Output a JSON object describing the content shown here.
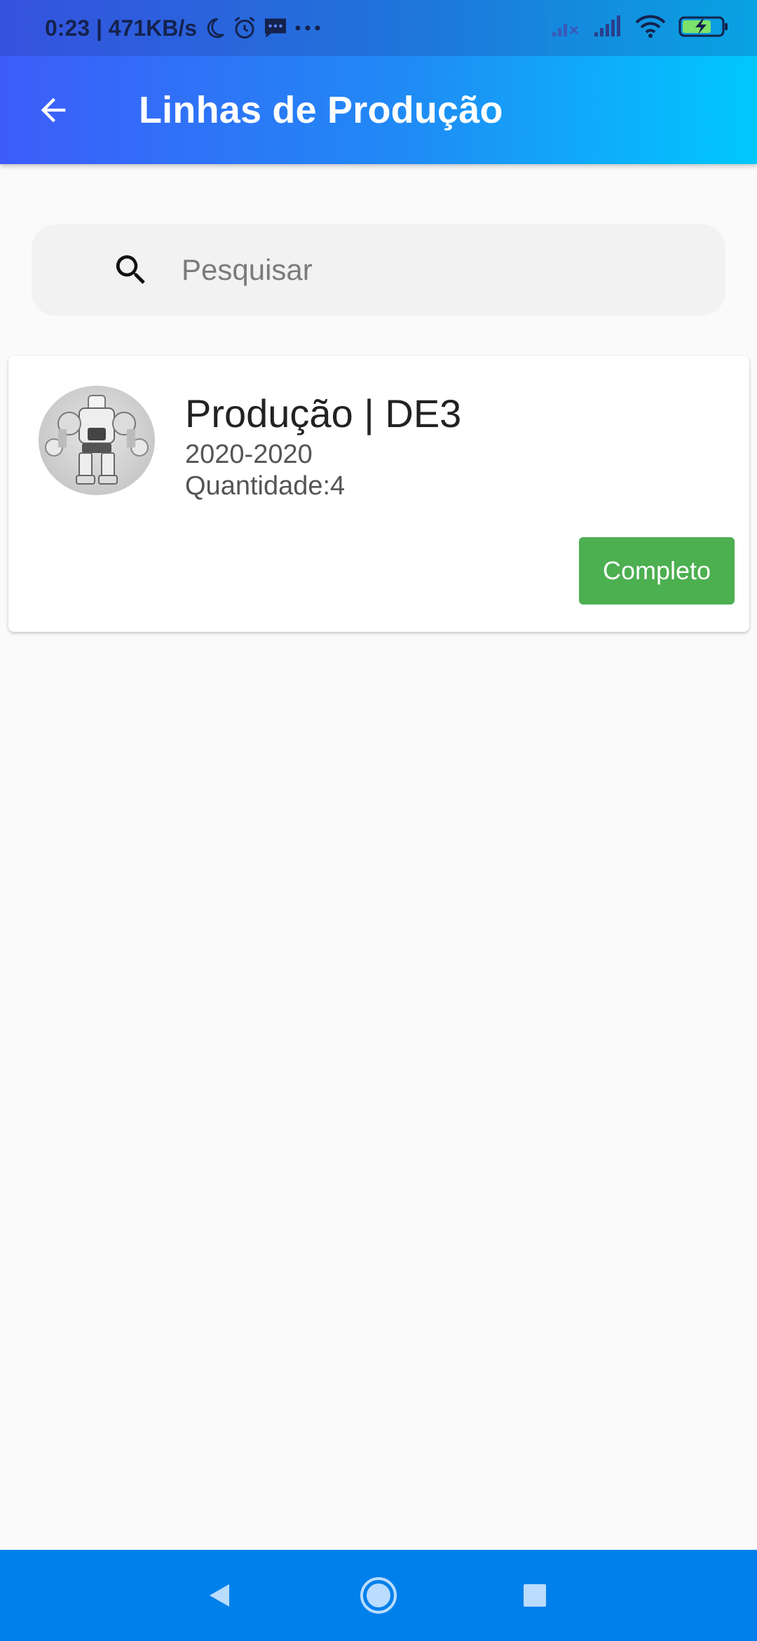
{
  "status_bar": {
    "time_speed": "0:23 | 471KB/s",
    "icons": [
      "moon-icon",
      "alarm-icon",
      "message-icon",
      "more-dots-icon",
      "signal-off-icon",
      "signal-icon",
      "wifi-icon",
      "battery-charging-icon"
    ]
  },
  "app_bar": {
    "title": "Linhas de Produção",
    "back_icon": "arrow-left-icon"
  },
  "search": {
    "placeholder": "Pesquisar",
    "value": "",
    "icon": "search-icon"
  },
  "list": {
    "items": [
      {
        "title": "Produção | DE3",
        "years": "2020-2020",
        "quantity": "Quantidade:4",
        "status_label": "Completo",
        "status_color": "#4caf50",
        "avatar_icon": "robot-icon"
      }
    ]
  },
  "nav_bar": {
    "buttons": [
      "back-triangle-icon",
      "home-circle-icon",
      "recents-square-icon"
    ]
  },
  "colors": {
    "gradient_start": "#3d5cfa",
    "gradient_end": "#00c8ff",
    "nav_bar": "#0080ea",
    "background": "#fafafa"
  }
}
